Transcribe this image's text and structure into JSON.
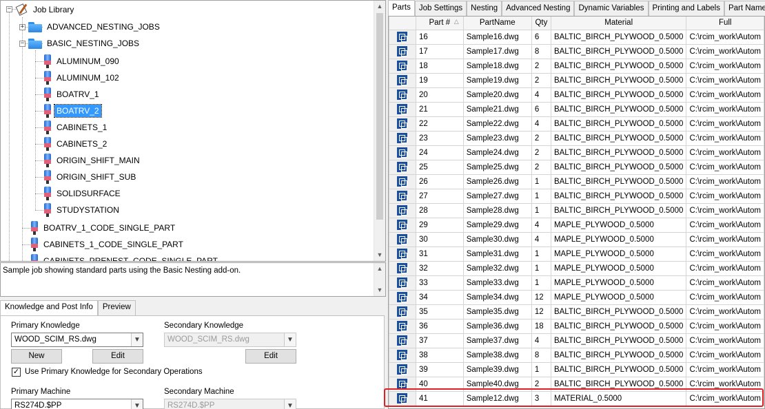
{
  "tree": {
    "root": "Job Library",
    "folders": [
      {
        "label": "ADVANCED_NESTING_JOBS",
        "expander": "+"
      },
      {
        "label": "BASIC_NESTING_JOBS",
        "expander": "−"
      }
    ],
    "basic_jobs": [
      "ALUMINUM_090",
      "ALUMINUM_102",
      "BOATRV_1",
      "BOATRV_2",
      "CABINETS_1",
      "CABINETS_2",
      "ORIGIN_SHIFT_MAIN",
      "ORIGIN_SHIFT_SUB",
      "SOLIDSURFACE",
      "STUDYSTATION"
    ],
    "selected": "BOATRV_2",
    "root_jobs": [
      "BOATRV_1_CODE_SINGLE_PART",
      "CABINETS_1_CODE_SINGLE_PART",
      "CABINETS_PRENEST_CODE_SINGLE_PART"
    ]
  },
  "description": "Sample job showing standard parts using the Basic Nesting add-on.",
  "left_tabs": [
    "Knowledge and Post Info",
    "Preview"
  ],
  "knowledge": {
    "primary_label": "Primary Knowledge",
    "primary_value": "WOOD_SCIM_RS.dwg",
    "secondary_label": "Secondary Knowledge",
    "secondary_value": "WOOD_SCIM_RS.dwg",
    "new_btn": "New",
    "edit_btn": "Edit",
    "edit2_btn": "Edit",
    "checkbox_label": "Use Primary Knowledge for Secondary Operations",
    "checkbox_mark": "✓",
    "primary_machine_label": "Primary Machine",
    "primary_machine_value": "RS274D.$PP",
    "secondary_machine_label": "Secondary Machine",
    "secondary_machine_value": "RS274D.$PP"
  },
  "right_tabs": [
    "Parts",
    "Job Settings",
    "Nesting",
    "Advanced Nesting",
    "Dynamic Variables",
    "Printing and Labels",
    "Part Name"
  ],
  "grid": {
    "columns": [
      "",
      "Part #",
      "PartName",
      "Qty",
      "Material",
      "Full"
    ],
    "rows": [
      [
        "16",
        "Sample16.dwg",
        "6",
        "BALTIC_BIRCH_PLYWOOD_0.5000",
        "C:\\rcim_work\\Autom"
      ],
      [
        "17",
        "Sample17.dwg",
        "8",
        "BALTIC_BIRCH_PLYWOOD_0.5000",
        "C:\\rcim_work\\Autom"
      ],
      [
        "18",
        "Sample18.dwg",
        "2",
        "BALTIC_BIRCH_PLYWOOD_0.5000",
        "C:\\rcim_work\\Autom"
      ],
      [
        "19",
        "Sample19.dwg",
        "2",
        "BALTIC_BIRCH_PLYWOOD_0.5000",
        "C:\\rcim_work\\Autom"
      ],
      [
        "20",
        "Sample20.dwg",
        "4",
        "BALTIC_BIRCH_PLYWOOD_0.5000",
        "C:\\rcim_work\\Autom"
      ],
      [
        "21",
        "Sample21.dwg",
        "6",
        "BALTIC_BIRCH_PLYWOOD_0.5000",
        "C:\\rcim_work\\Autom"
      ],
      [
        "22",
        "Sample22.dwg",
        "4",
        "BALTIC_BIRCH_PLYWOOD_0.5000",
        "C:\\rcim_work\\Autom"
      ],
      [
        "23",
        "Sample23.dwg",
        "2",
        "BALTIC_BIRCH_PLYWOOD_0.5000",
        "C:\\rcim_work\\Autom"
      ],
      [
        "24",
        "Sample24.dwg",
        "2",
        "BALTIC_BIRCH_PLYWOOD_0.5000",
        "C:\\rcim_work\\Autom"
      ],
      [
        "25",
        "Sample25.dwg",
        "2",
        "BALTIC_BIRCH_PLYWOOD_0.5000",
        "C:\\rcim_work\\Autom"
      ],
      [
        "26",
        "Sample26.dwg",
        "1",
        "BALTIC_BIRCH_PLYWOOD_0.5000",
        "C:\\rcim_work\\Autom"
      ],
      [
        "27",
        "Sample27.dwg",
        "1",
        "BALTIC_BIRCH_PLYWOOD_0.5000",
        "C:\\rcim_work\\Autom"
      ],
      [
        "28",
        "Sample28.dwg",
        "1",
        "BALTIC_BIRCH_PLYWOOD_0.5000",
        "C:\\rcim_work\\Autom"
      ],
      [
        "29",
        "Sample29.dwg",
        "4",
        "MAPLE_PLYWOOD_0.5000",
        "C:\\rcim_work\\Autom"
      ],
      [
        "30",
        "Sample30.dwg",
        "4",
        "MAPLE_PLYWOOD_0.5000",
        "C:\\rcim_work\\Autom"
      ],
      [
        "31",
        "Sample31.dwg",
        "1",
        "MAPLE_PLYWOOD_0.5000",
        "C:\\rcim_work\\Autom"
      ],
      [
        "32",
        "Sample32.dwg",
        "1",
        "MAPLE_PLYWOOD_0.5000",
        "C:\\rcim_work\\Autom"
      ],
      [
        "33",
        "Sample33.dwg",
        "1",
        "MAPLE_PLYWOOD_0.5000",
        "C:\\rcim_work\\Autom"
      ],
      [
        "34",
        "Sample34.dwg",
        "12",
        "MAPLE_PLYWOOD_0.5000",
        "C:\\rcim_work\\Autom"
      ],
      [
        "35",
        "Sample35.dwg",
        "12",
        "BALTIC_BIRCH_PLYWOOD_0.5000",
        "C:\\rcim_work\\Autom"
      ],
      [
        "36",
        "Sample36.dwg",
        "18",
        "BALTIC_BIRCH_PLYWOOD_0.5000",
        "C:\\rcim_work\\Autom"
      ],
      [
        "37",
        "Sample37.dwg",
        "4",
        "BALTIC_BIRCH_PLYWOOD_0.5000",
        "C:\\rcim_work\\Autom"
      ],
      [
        "38",
        "Sample38.dwg",
        "8",
        "BALTIC_BIRCH_PLYWOOD_0.5000",
        "C:\\rcim_work\\Autom"
      ],
      [
        "39",
        "Sample39.dwg",
        "1",
        "BALTIC_BIRCH_PLYWOOD_0.5000",
        "C:\\rcim_work\\Autom"
      ],
      [
        "40",
        "Sample40.dwg",
        "2",
        "BALTIC_BIRCH_PLYWOOD_0.5000",
        "C:\\rcim_work\\Autom"
      ],
      [
        "41",
        "Sample12.dwg",
        "3",
        "MATERIAL_0.5000",
        "C:\\rcim_work\\Autom"
      ]
    ]
  },
  "colors": {
    "selection": "#3399ff",
    "highlight_box": "#e02020",
    "part_icon": "#1a4f9e"
  },
  "icons": {
    "part_row": "part-icon",
    "folder": "folder-icon",
    "job": "job-icon",
    "library": "library-icon"
  }
}
